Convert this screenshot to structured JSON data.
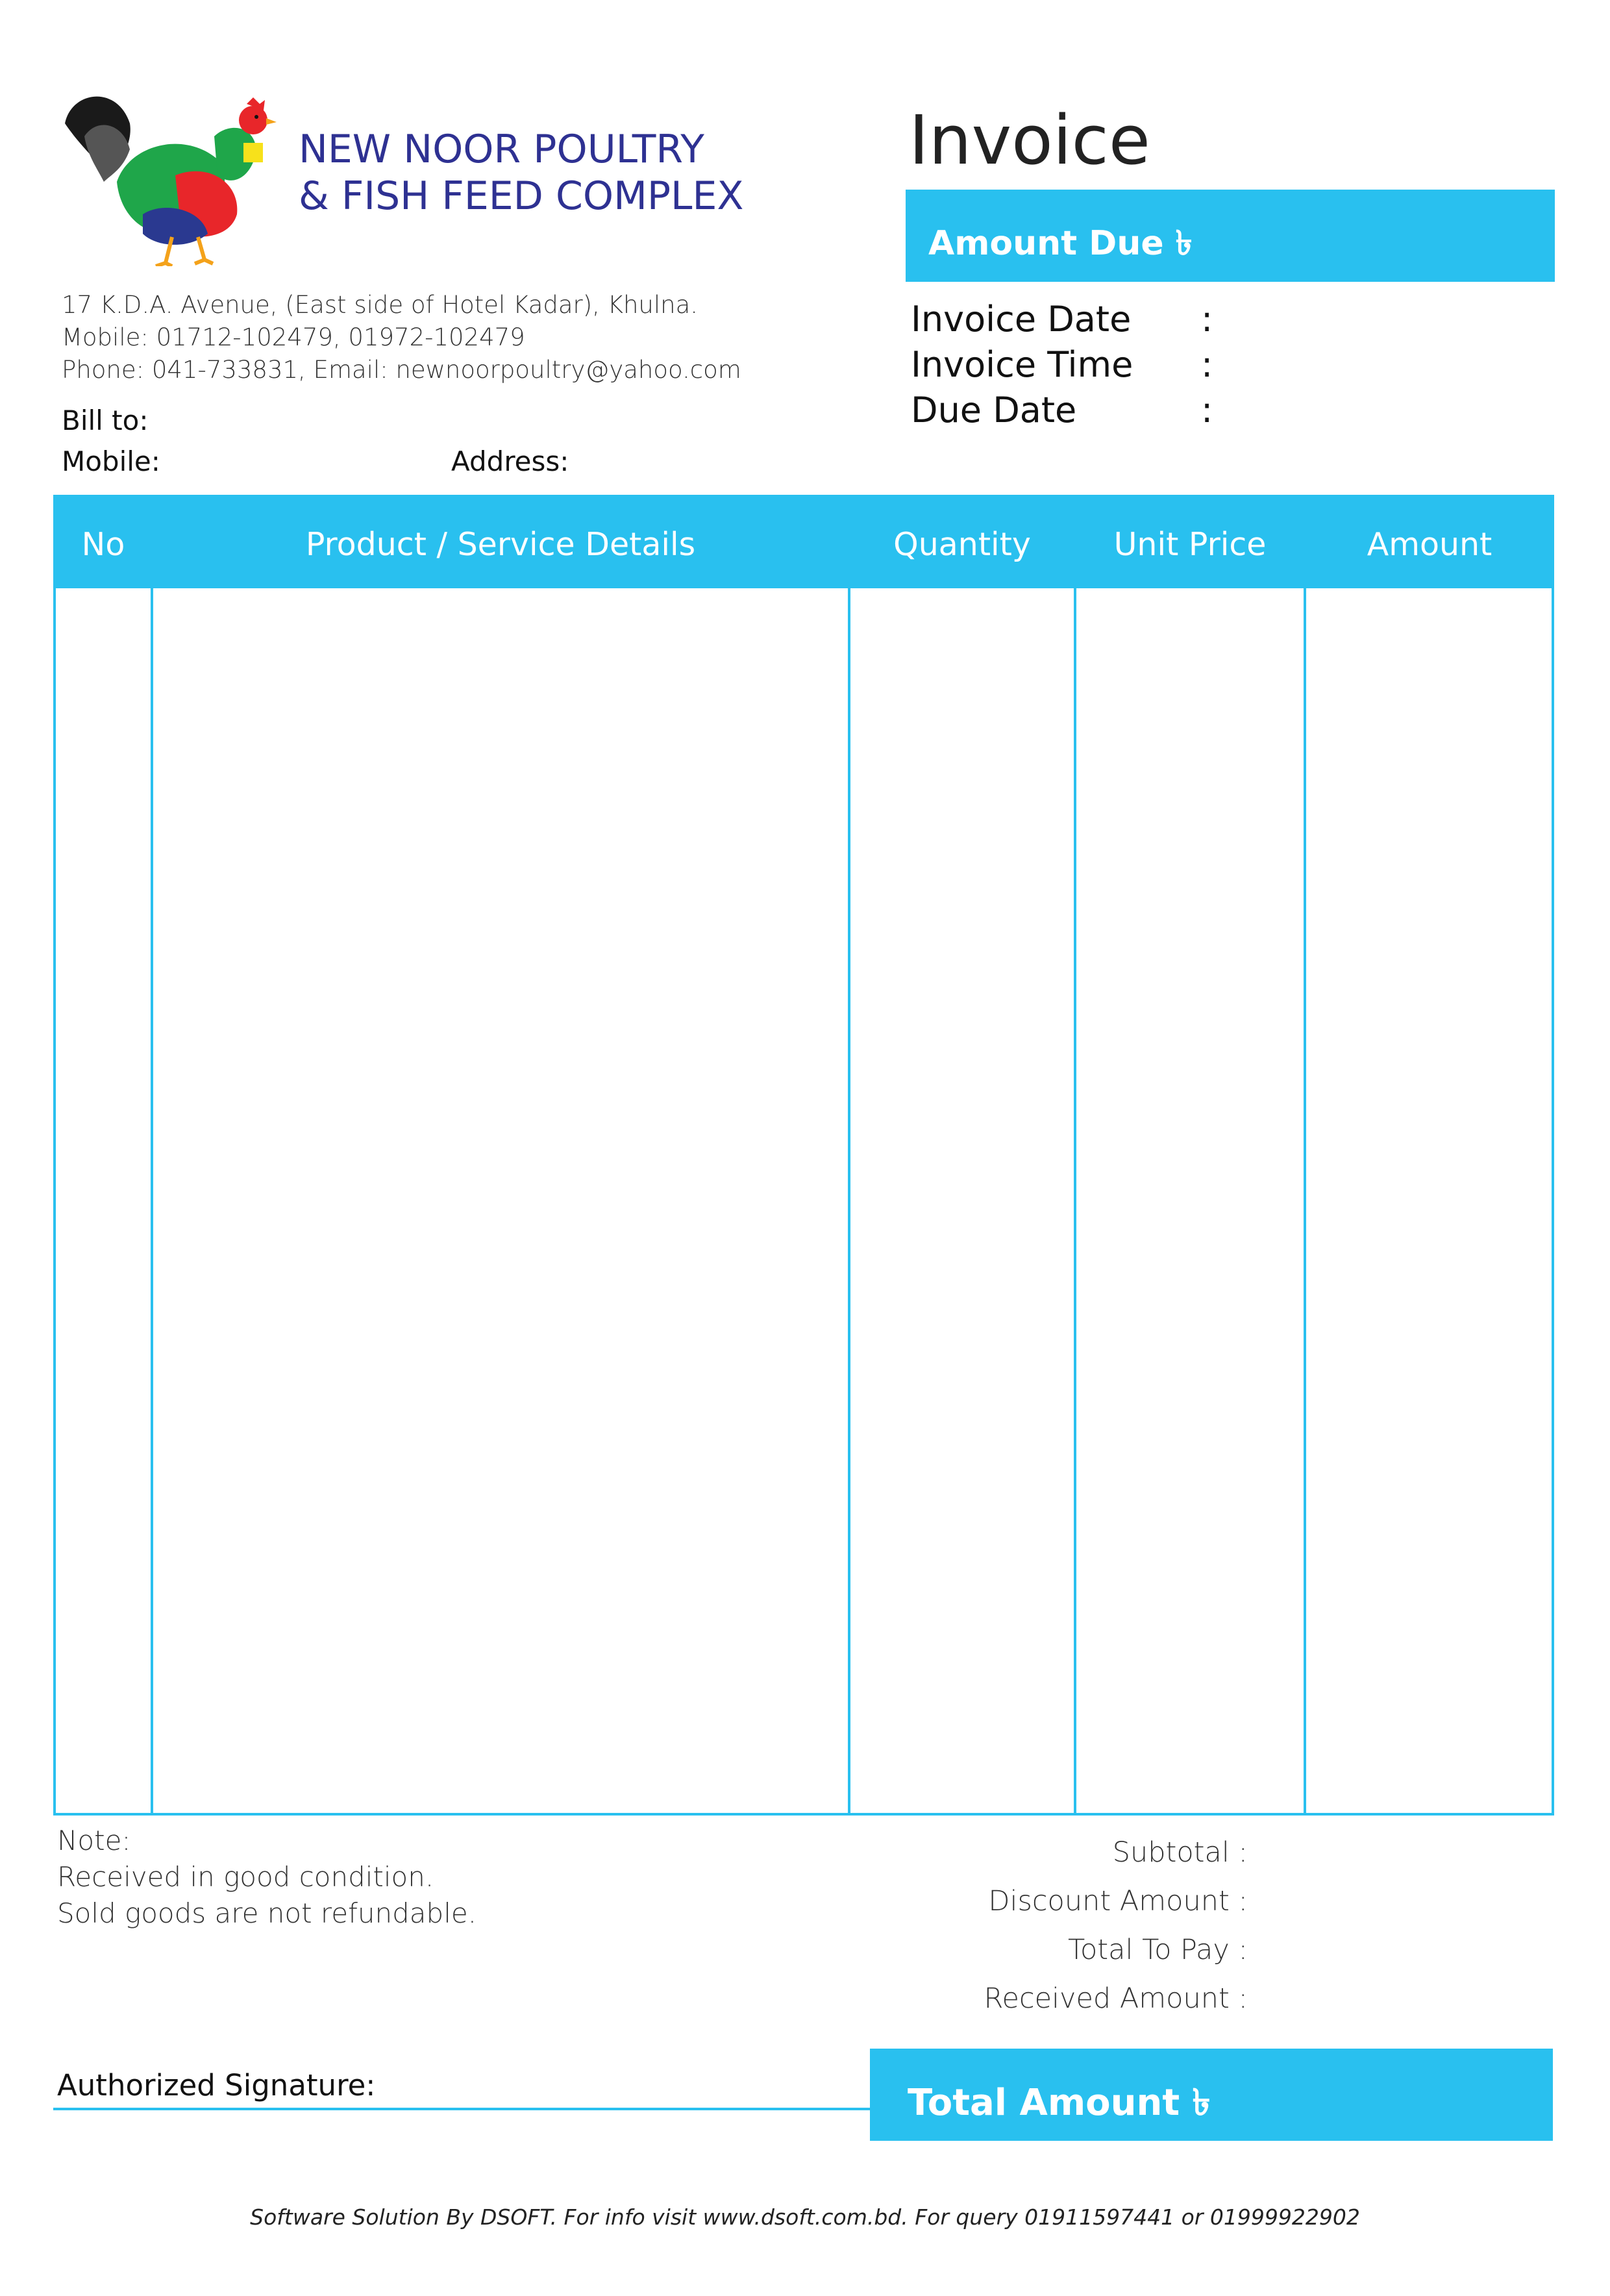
{
  "company": {
    "name_line1": "NEW NOOR POULTRY",
    "name_line2": "& FISH FEED COMPLEX",
    "address": "17 K.D.A. Avenue, (East side of Hotel Kadar), Khulna.",
    "mobile": "Mobile: 01712-102479, 01972-102479",
    "phone_email": "Phone: 041-733831, Email: newnoorpoultry@yahoo.com",
    "logo_icon": "rooster-icon"
  },
  "customer": {
    "bill_to_label": "Bill to:",
    "mobile_label": "Mobile:",
    "address_label": "Address:"
  },
  "invoice": {
    "title": "Invoice",
    "amount_due_label": "Amount Due ৳",
    "date_label": "Invoice Date",
    "time_label": "Invoice Time",
    "due_date_label": "Due Date",
    "colon": ":"
  },
  "table": {
    "columns": [
      "No",
      "Product / Service Details",
      "Quantity",
      "Unit Price",
      "Amount"
    ],
    "rows": []
  },
  "notes": {
    "title": "Note:",
    "line1": "Received in good condition.",
    "line2": "Sold goods are not refundable."
  },
  "summary": {
    "subtotal": "Subtotal :",
    "discount": "Discount Amount :",
    "total_to_pay": "Total To Pay :",
    "received": "Received Amount :",
    "total_amount_label": "Total Amount ৳"
  },
  "signature": {
    "label": "Authorized Signature:"
  },
  "footer": {
    "text": "Software Solution By DSOFT. For info visit www.dsoft.com.bd. For query 01911597441 or 01999922902"
  },
  "colors": {
    "accent": "#29c0ef",
    "company_name": "#2e3192"
  }
}
